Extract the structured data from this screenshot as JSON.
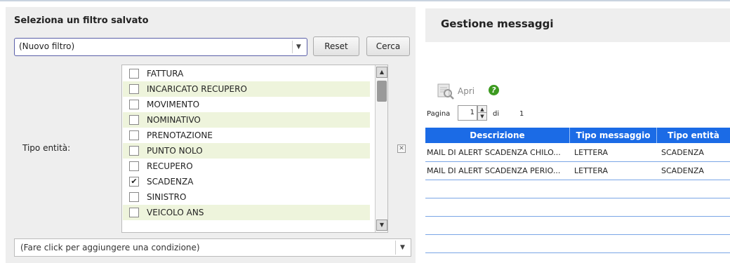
{
  "filter_panel": {
    "title": "Seleziona un filtro salvato",
    "saved_filter_value": "(Nuovo filtro)",
    "reset_label": "Reset",
    "search_label": "Cerca",
    "entity_type_label": "Tipo entità:",
    "entity_types": [
      {
        "label": "FATTURA",
        "checked": false
      },
      {
        "label": "INCARICATO RECUPERO",
        "checked": false
      },
      {
        "label": "MOVIMENTO",
        "checked": false
      },
      {
        "label": "NOMINATIVO",
        "checked": false
      },
      {
        "label": "PRENOTAZIONE",
        "checked": false
      },
      {
        "label": "PUNTO NOLO",
        "checked": false
      },
      {
        "label": "RECUPERO",
        "checked": false
      },
      {
        "label": "SCADENZA",
        "checked": true
      },
      {
        "label": "SINISTRO",
        "checked": false
      },
      {
        "label": "VEICOLO ANS",
        "checked": false
      }
    ],
    "add_condition_value": "(Fare click per aggiungere una condizione)"
  },
  "messages_panel": {
    "title": "Gestione messaggi",
    "open_label": "Apri",
    "page_label": "Pagina",
    "page_value": "1",
    "of_label": "di",
    "total_pages": "1",
    "columns": [
      "Descrizione",
      "Tipo messaggio",
      "Tipo entità"
    ],
    "rows": [
      [
        "MAIL DI ALERT SCADENZA CHILO...",
        "LETTERA",
        "SCADENZA"
      ],
      [
        "MAIL DI ALERT SCADENZA PERIO...",
        "LETTERA",
        "SCADENZA"
      ]
    ]
  },
  "icons": {
    "open": "document-open-icon",
    "help": "help-icon",
    "remove": "remove-condition-icon",
    "check": "checkmark-icon"
  },
  "colors": {
    "grid_header": "#1b6be6",
    "alt_row": "#eef4dc",
    "help_green": "#3c9a1f"
  }
}
